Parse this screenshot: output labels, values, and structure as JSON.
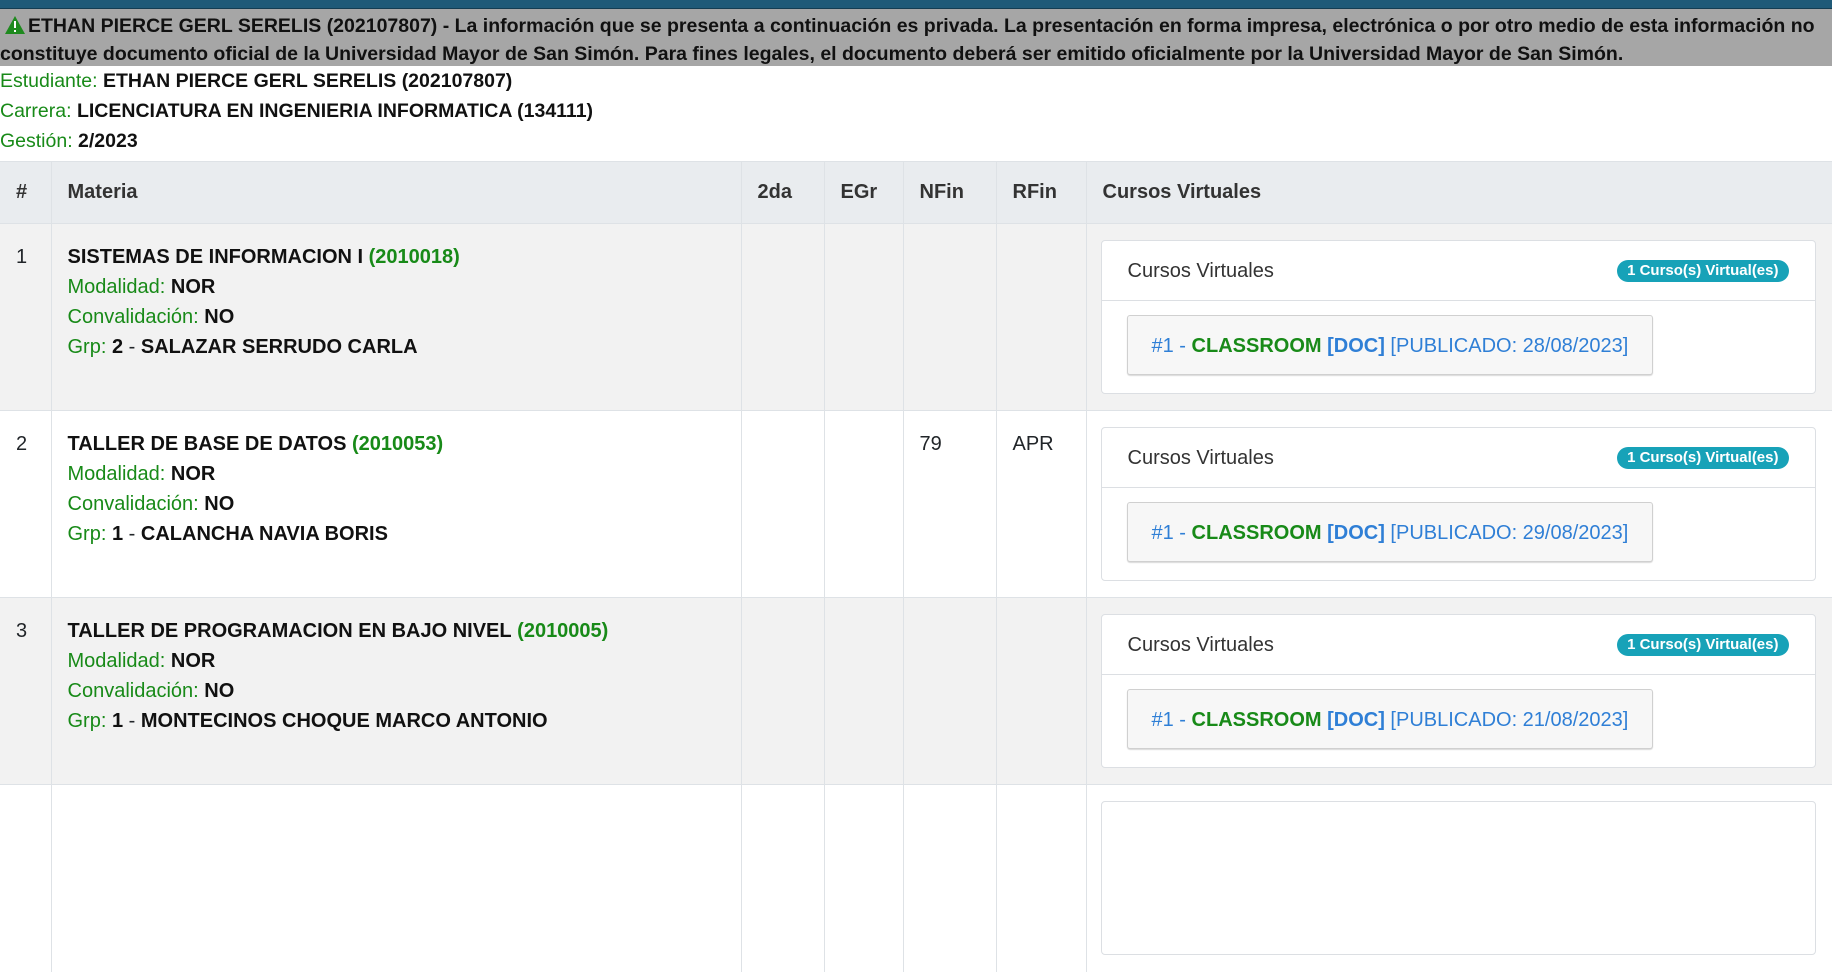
{
  "notice": {
    "text": "ETHAN PIERCE GERL SERELIS (202107807) - La información que se presenta a continuación es privada. La presentación en forma impresa, electrónica o por otro medio de esta información no constituye documento oficial de la Universidad Mayor de San Simón. Para fines legales, el documento deberá ser emitido oficialmente por la Universidad Mayor de San Simón.",
    "icon": "warning-icon",
    "icon_color": "#1e8a1e"
  },
  "student": {
    "estudiante_label": "Estudiante:",
    "estudiante": "ETHAN PIERCE GERL SERELIS (202107807)",
    "carrera_label": "Carrera:",
    "carrera": "LICENCIATURA EN INGENIERIA INFORMATICA (134111)",
    "gestion_label": "Gestión:",
    "gestion": "2/2023"
  },
  "table": {
    "headers": [
      "#",
      "Materia",
      "2da",
      "EGr",
      "NFin",
      "RFin",
      "Cursos Virtuales"
    ],
    "rows": [
      {
        "num": "1",
        "name": "SISTEMAS DE INFORMACION I",
        "code": "(2010018)",
        "modalidad_label": "Modalidad:",
        "modalidad": "NOR",
        "convalidacion_label": "Convalidación:",
        "convalidacion": "NO",
        "grp_label": "Grp:",
        "grp": "2",
        "sep": "-",
        "docente": "SALAZAR SERRUDO CARLA",
        "segunda": "",
        "egr": "",
        "nfin": "",
        "rfin": "",
        "card_title": "Cursos Virtuales",
        "badge": "1 Curso(s) Virtual(es)",
        "course_num": "#1 -",
        "course_type": "CLASSROOM",
        "course_doc": "[DOC]",
        "course_pub": "[PUBLICADO: 28/08/2023]"
      },
      {
        "num": "2",
        "name": "TALLER DE BASE DE DATOS",
        "code": "(2010053)",
        "modalidad_label": "Modalidad:",
        "modalidad": "NOR",
        "convalidacion_label": "Convalidación:",
        "convalidacion": "NO",
        "grp_label": "Grp:",
        "grp": "1",
        "sep": "-",
        "docente": "CALANCHA NAVIA BORIS",
        "segunda": "",
        "egr": "",
        "nfin": "79",
        "rfin": "APR",
        "card_title": "Cursos Virtuales",
        "badge": "1 Curso(s) Virtual(es)",
        "course_num": "#1 -",
        "course_type": "CLASSROOM",
        "course_doc": "[DOC]",
        "course_pub": "[PUBLICADO: 29/08/2023]"
      },
      {
        "num": "3",
        "name": "TALLER DE PROGRAMACION EN BAJO NIVEL",
        "code": "(2010005)",
        "modalidad_label": "Modalidad:",
        "modalidad": "NOR",
        "convalidacion_label": "Convalidación:",
        "convalidacion": "NO",
        "grp_label": "Grp:",
        "grp": "1",
        "sep": "-",
        "docente": "MONTECINOS CHOQUE MARCO ANTONIO",
        "segunda": "",
        "egr": "",
        "nfin": "",
        "rfin": "",
        "card_title": "Cursos Virtuales",
        "badge": "1 Curso(s) Virtual(es)",
        "course_num": "#1 -",
        "course_type": "CLASSROOM",
        "course_doc": "[DOC]",
        "course_pub": "[PUBLICADO: 21/08/2023]"
      }
    ]
  },
  "colors": {
    "label_green": "#188a18",
    "link_blue": "#2f7fd6",
    "badge_teal": "#17a2b8",
    "notice_gray": "#a6a6a6"
  }
}
